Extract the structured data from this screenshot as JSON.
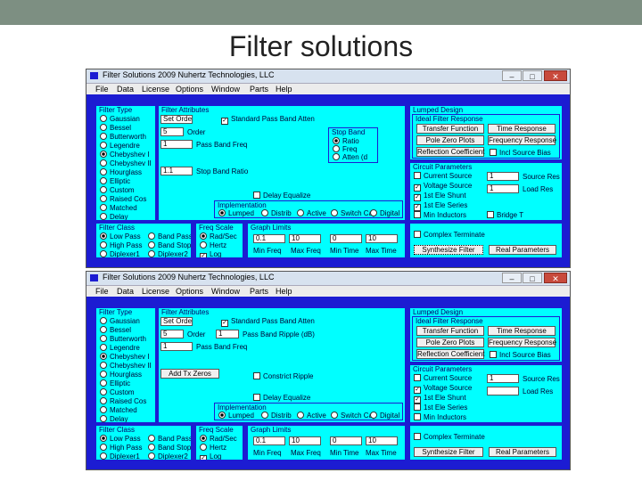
{
  "slide": {
    "title": "Filter solutions"
  },
  "window1": {
    "title": "Filter Solutions 2009    Nuhertz Technologies, LLC",
    "menu": [
      "File",
      "Data",
      "License",
      "Options",
      "Window",
      "Parts",
      "Help"
    ],
    "filter_type": {
      "label": "Filter Type",
      "items": [
        "Gaussian",
        "Bessel",
        "Butterworth",
        "Legendre",
        "Chebyshev I",
        "Chebyshev II",
        "Hourglass",
        "Elliptic",
        "Custom",
        "Raised Cos",
        "Matched",
        "Delay"
      ],
      "selected": "Chebyshev I"
    },
    "filter_attributes": {
      "label": "Filter Attributes",
      "order_value": "Set Order",
      "order_label": "Order",
      "order_num": "5",
      "ripple_value": "1",
      "ripple_label": "Pass Band Freq",
      "standard_label": "Standard Pass Band Atten",
      "stop_band_value": "1.1",
      "stop_band_label": "Stop Band Ratio",
      "delay_equalize": "Delay Equalize",
      "stop_band_group": "Stop Band",
      "stop_band_opts": [
        "Ratio",
        "Freq",
        "Atten (d"
      ],
      "stop_band_selected": "Ratio"
    },
    "implementation": {
      "label": "Implementation",
      "opts": [
        "Lumped",
        "Distrib",
        "Active",
        "Switch Cap",
        "Digital"
      ],
      "selected": "Lumped"
    },
    "filter_class": {
      "label": "Filter Class",
      "opts": [
        "Low Pass",
        "Band Pass",
        "High Pass",
        "Band Stop",
        "Diplexer1",
        "Diplexer2"
      ],
      "selected": "Low Pass"
    },
    "freq_scale": {
      "label": "Freq Scale",
      "opts": [
        "Rad/Sec",
        "Hertz"
      ],
      "selected": "Rad/Sec",
      "log": "Log"
    },
    "graph_limits": {
      "label": "Graph Limits",
      "values": [
        "0.1",
        "10",
        "0",
        "10"
      ],
      "labels": [
        "Min Freq",
        "Max Freq",
        "Min Time",
        "Max Time"
      ]
    },
    "lumped": {
      "label": "Lumped Design",
      "ideal": "Ideal Filter Response",
      "buttons": [
        "Transfer Function",
        "Time Response",
        "Pole Zero Plots",
        "Frequency Response",
        "Reflection Coefficient"
      ],
      "incl_source_bias": "Incl Source Bias"
    },
    "circuit": {
      "label": "Circuit Parameters",
      "checks": [
        "Current Source",
        "Voltage Source",
        "1st Ele Shunt",
        "1st Ele Series",
        "Min Inductors"
      ],
      "checked": [
        false,
        true,
        true,
        true,
        false
      ],
      "source_res_value": "1",
      "source_res_label": "Source Res",
      "load_res_value": "1",
      "load_res_label": "Load Res",
      "bridge": "Bridge T"
    },
    "complex_terminate": "Complex Terminate",
    "synthesize": "Synthesize Filter",
    "real_parameters": "Real Parameters"
  },
  "window2": {
    "title": "Filter Solutions 2009    Nuhertz Technologies, LLC",
    "menu": [
      "File",
      "Data",
      "License",
      "Options",
      "Window",
      "Parts",
      "Help"
    ],
    "filter_type": {
      "label": "Filter Type",
      "items": [
        "Gaussian",
        "Bessel",
        "Butterworth",
        "Legendre",
        "Chebyshev I",
        "Chebyshev II",
        "Hourglass",
        "Elliptic",
        "Custom",
        "Raised Cos",
        "Matched",
        "Delay"
      ],
      "selected": "Chebyshev I"
    },
    "filter_attributes": {
      "label": "Filter Attributes",
      "order_value": "Set Order",
      "order_label": "Order",
      "order_num": "5",
      "ripple_value": "1",
      "ripple_label": "Pass Band Ripple (dB)",
      "freq_value": "1",
      "freq_label": "Pass Band Freq",
      "standard_label": "Standard Pass Band Atten",
      "add_tx_zeros": "Add Tx Zeros",
      "constrict": "Constrict Ripple",
      "delay_equalize": "Delay Equalize"
    },
    "implementation": {
      "label": "Implementation",
      "opts": [
        "Lumped",
        "Distrib",
        "Active",
        "Switch Cap",
        "Digital"
      ],
      "selected": "Lumped"
    },
    "filter_class": {
      "label": "Filter Class",
      "opts": [
        "Low Pass",
        "Band Pass",
        "High Pass",
        "Band Stop",
        "Diplexer1",
        "Diplexer2"
      ],
      "selected": "Low Pass"
    },
    "freq_scale": {
      "label": "Freq Scale",
      "opts": [
        "Rad/Sec",
        "Hertz"
      ],
      "selected": "Rad/Sec",
      "log": "Log"
    },
    "graph_limits": {
      "label": "Graph Limits",
      "values": [
        "0.1",
        "10",
        "0",
        "10"
      ],
      "labels": [
        "Min Freq",
        "Max Freq",
        "Min Time",
        "Max Time"
      ]
    },
    "lumped": {
      "label": "Lumped Design",
      "ideal": "Ideal Filter Response",
      "buttons": [
        "Transfer Function",
        "Time Response",
        "Pole Zero Plots",
        "Frequency Response",
        "Reflection Coefficient"
      ],
      "incl_source_bias": "Incl Source Bias"
    },
    "circuit": {
      "label": "Circuit Parameters",
      "checks": [
        "Current Source",
        "Voltage Source",
        "1st Ele Shunt",
        "1st Ele Series",
        "Min Inductors"
      ],
      "checked": [
        false,
        true,
        true,
        false,
        false
      ],
      "source_res_value": "1",
      "source_res_label": "Source Res",
      "load_res_value": "",
      "load_res_label": "Load Res"
    },
    "complex_terminate": "Complex Terminate",
    "synthesize": "Synthesize Filter",
    "real_parameters": "Real Parameters"
  }
}
